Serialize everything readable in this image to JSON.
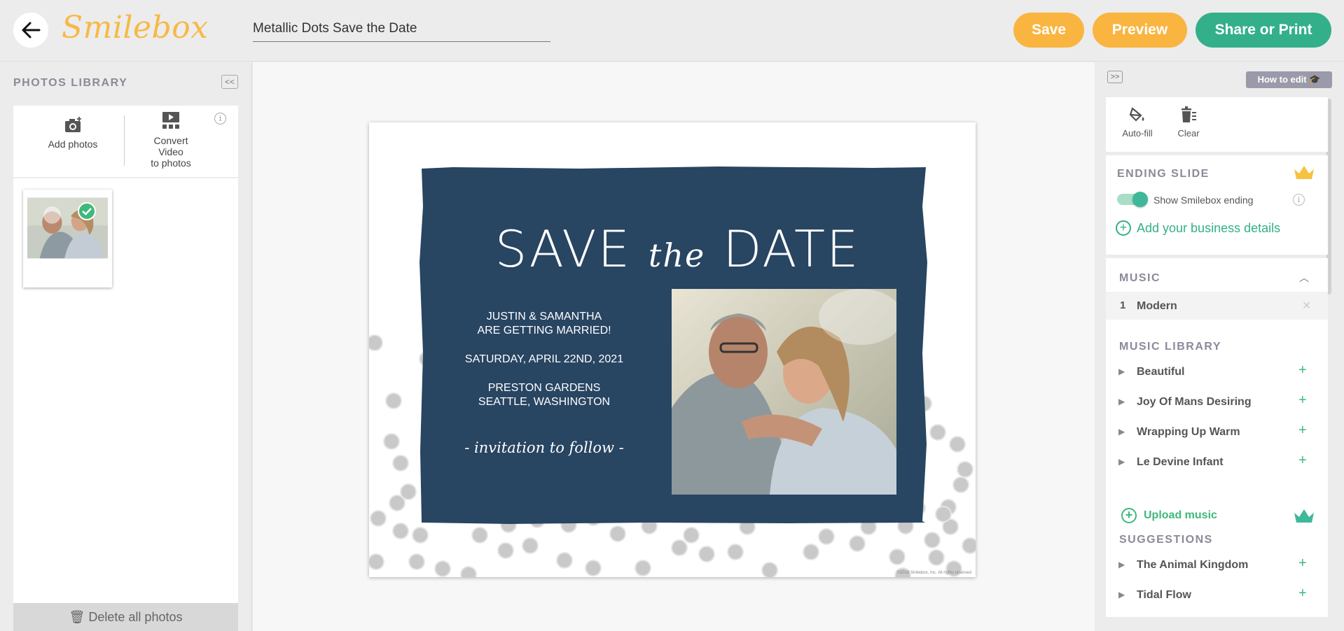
{
  "header": {
    "logo": "Smilebox",
    "project_title": "Metallic Dots Save the Date",
    "save_label": "Save",
    "preview_label": "Preview",
    "share_label": "Share or Print"
  },
  "left_panel": {
    "title": "PHOTOS LIBRARY",
    "collapse_label": "<<",
    "add_photos_label": "Add photos",
    "convert_video_line1": "Convert",
    "convert_video_line2": "Video",
    "convert_video_line3": "to photos",
    "info_glyph": "i",
    "delete_all_label": "Delete all photos"
  },
  "card": {
    "headline_1": "SAVE",
    "headline_the": "the",
    "headline_2": "DATE",
    "couple_line1": "JUSTIN & SAMANTHA",
    "couple_line2": "ARE GETTING MARRIED!",
    "date_line": "SATURDAY, APRIL 22ND, 2021",
    "venue_line1": "PRESTON GARDENS",
    "venue_line2": "SEATTLE, WASHINGTON",
    "invite_line": "- invitation to follow -",
    "copyright": "©2018 Smilebox, Inc. All rights reserved",
    "panel_color": "#284562"
  },
  "right_panel": {
    "expand_label": ">>",
    "how_to_edit_label": "How to edit",
    "autofill_label": "Auto-fill",
    "clear_label": "Clear",
    "ending_title": "ENDING SLIDE",
    "show_ending_label": "Show Smilebox ending",
    "show_ending_on": true,
    "info_glyph": "i",
    "add_business_label": "Add your business details",
    "music_title": "MUSIC",
    "selected_track": {
      "number": "1",
      "name": "Modern"
    },
    "music_library_title": "MUSIC LIBRARY",
    "library_tracks": [
      "Beautiful",
      "Joy Of Mans Desiring",
      "Wrapping Up Warm",
      "Le Devine Infant"
    ],
    "upload_music_label": "Upload music",
    "suggestions_title": "SUGGESTIONS",
    "suggestion_tracks": [
      "The Animal Kingdom",
      "Tidal Flow"
    ]
  },
  "colors": {
    "accent_yellow": "#f9b53f",
    "accent_green": "#33b08a",
    "crown_yellow": "#f5c242",
    "crown_green": "#3fb89a"
  }
}
